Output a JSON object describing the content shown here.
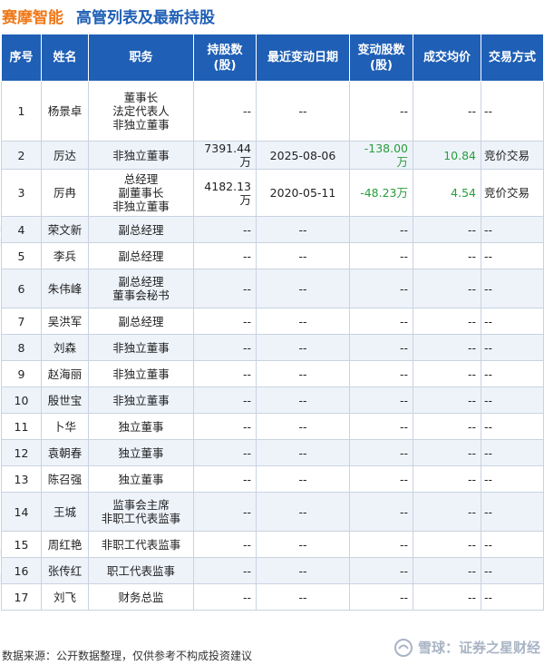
{
  "header": {
    "brand": "赛摩智能",
    "title": "高管列表及最新持股"
  },
  "table": {
    "columns": [
      "序号",
      "姓名",
      "职务",
      "持股数\n(股)",
      "最近变动日期",
      "变动股数\n(股)",
      "成交均价",
      "交易方式"
    ],
    "rows": [
      {
        "no": "1",
        "name": "杨景卓",
        "roles": [
          "董事长",
          "法定代表人",
          "非独立董事"
        ],
        "shares": "--",
        "date": "--",
        "change": "--",
        "price": "--",
        "method": "--"
      },
      {
        "no": "2",
        "name": "厉达",
        "roles": [
          "非独立董事"
        ],
        "shares": "7391.44万",
        "date": "2025-08-06",
        "change": "-138.00万",
        "price": "10.84",
        "method": "竞价交易"
      },
      {
        "no": "3",
        "name": "厉冉",
        "roles": [
          "总经理",
          "副董事长",
          "非独立董事"
        ],
        "shares": "4182.13万",
        "date": "2020-05-11",
        "change": "-48.23万",
        "price": "4.54",
        "method": "竞价交易"
      },
      {
        "no": "4",
        "name": "荣文新",
        "roles": [
          "副总经理"
        ],
        "shares": "--",
        "date": "--",
        "change": "--",
        "price": "--",
        "method": "--"
      },
      {
        "no": "5",
        "name": "李兵",
        "roles": [
          "副总经理"
        ],
        "shares": "--",
        "date": "--",
        "change": "--",
        "price": "--",
        "method": "--"
      },
      {
        "no": "6",
        "name": "朱伟峰",
        "roles": [
          "副总经理",
          "董事会秘书"
        ],
        "shares": "--",
        "date": "--",
        "change": "--",
        "price": "--",
        "method": "--"
      },
      {
        "no": "7",
        "name": "吴洪军",
        "roles": [
          "副总经理"
        ],
        "shares": "--",
        "date": "--",
        "change": "--",
        "price": "--",
        "method": "--"
      },
      {
        "no": "8",
        "name": "刘森",
        "roles": [
          "非独立董事"
        ],
        "shares": "--",
        "date": "--",
        "change": "--",
        "price": "--",
        "method": "--"
      },
      {
        "no": "9",
        "name": "赵海丽",
        "roles": [
          "非独立董事"
        ],
        "shares": "--",
        "date": "--",
        "change": "--",
        "price": "--",
        "method": "--"
      },
      {
        "no": "10",
        "name": "殷世宝",
        "roles": [
          "非独立董事"
        ],
        "shares": "--",
        "date": "--",
        "change": "--",
        "price": "--",
        "method": "--"
      },
      {
        "no": "11",
        "name": "卜华",
        "roles": [
          "独立董事"
        ],
        "shares": "--",
        "date": "--",
        "change": "--",
        "price": "--",
        "method": "--"
      },
      {
        "no": "12",
        "name": "袁朝春",
        "roles": [
          "独立董事"
        ],
        "shares": "--",
        "date": "--",
        "change": "--",
        "price": "--",
        "method": "--"
      },
      {
        "no": "13",
        "name": "陈召强",
        "roles": [
          "独立董事"
        ],
        "shares": "--",
        "date": "--",
        "change": "--",
        "price": "--",
        "method": "--"
      },
      {
        "no": "14",
        "name": "王城",
        "roles": [
          "监事会主席",
          "非职工代表监事"
        ],
        "shares": "--",
        "date": "--",
        "change": "--",
        "price": "--",
        "method": "--"
      },
      {
        "no": "15",
        "name": "周红艳",
        "roles": [
          "非职工代表监事"
        ],
        "shares": "--",
        "date": "--",
        "change": "--",
        "price": "--",
        "method": "--"
      },
      {
        "no": "16",
        "name": "张传红",
        "roles": [
          "职工代表监事"
        ],
        "shares": "--",
        "date": "--",
        "change": "--",
        "price": "--",
        "method": "--"
      },
      {
        "no": "17",
        "name": "刘飞",
        "roles": [
          "财务总监"
        ],
        "shares": "--",
        "date": "--",
        "change": "--",
        "price": "--",
        "method": "--"
      }
    ]
  },
  "footer": {
    "source": "数据来源：公开数据整理，仅供参考不构成投资建议",
    "brand": "雪球：证券之星财经"
  },
  "watermark": "证券之星",
  "colors": {
    "brand_orange": "#f07818",
    "header_blue": "#1f5fb5",
    "negative_green": "#2a9d3c"
  }
}
